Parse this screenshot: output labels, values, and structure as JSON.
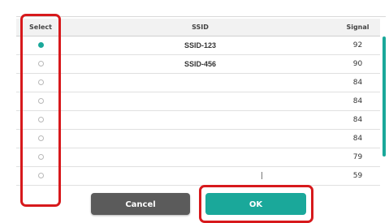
{
  "table": {
    "headers": {
      "select": "Select",
      "ssid": "SSID",
      "signal": "Signal"
    },
    "rows": [
      {
        "selected": true,
        "ssid": "SSID-123",
        "signal": "92"
      },
      {
        "selected": false,
        "ssid": "SSID-456",
        "signal": "90"
      },
      {
        "selected": false,
        "ssid": "",
        "signal": "84"
      },
      {
        "selected": false,
        "ssid": "",
        "signal": "84"
      },
      {
        "selected": false,
        "ssid": "",
        "signal": "84"
      },
      {
        "selected": false,
        "ssid": "",
        "signal": "84"
      },
      {
        "selected": false,
        "ssid": "",
        "signal": "79"
      },
      {
        "selected": false,
        "ssid": "",
        "signal": "59"
      }
    ]
  },
  "buttons": {
    "cancel_label": "Cancel",
    "ok_label": "OK"
  },
  "colors": {
    "accent": "#1aa89a",
    "highlight": "#d7191c",
    "cancel": "#5b5b5b"
  }
}
